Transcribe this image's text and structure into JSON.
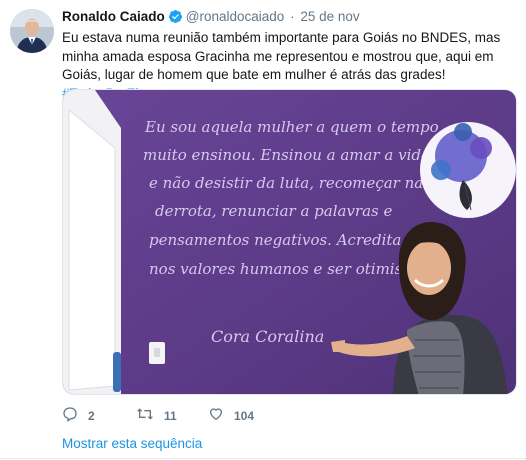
{
  "tweet": {
    "author_name": "Ronaldo Caiado",
    "handle": "@ronaldocaiado",
    "separator": "·",
    "date": "25 de nov",
    "text": "Eu estava numa reunião também  importante para Goiás no BNDES, mas minha amada esposa Gracinha me representou e mostrou que, aqui em Goiás, lugar de homem que bate em mulher é atrás das grades! ",
    "hashtag": "#TodosPorElas"
  },
  "mural": {
    "lines": [
      "Eu sou aquela mulher a quem o tempo",
      "muito ensinou. Ensinou a amar a vida",
      "e não desistir da luta, recomeçar na",
      "derrota, renunciar a palavras e",
      "pensamentos negativos. Acredita",
      "nos valores humanos e ser otimis"
    ],
    "signature": "Cora Coralina"
  },
  "actions": {
    "replies": "2",
    "retweets": "11",
    "likes": "104"
  },
  "show_thread": "Mostrar esta sequência",
  "colors": {
    "link": "#1b95e0",
    "muted": "#657786",
    "verified": "#1da1f2",
    "wall": "#5b3a86"
  }
}
